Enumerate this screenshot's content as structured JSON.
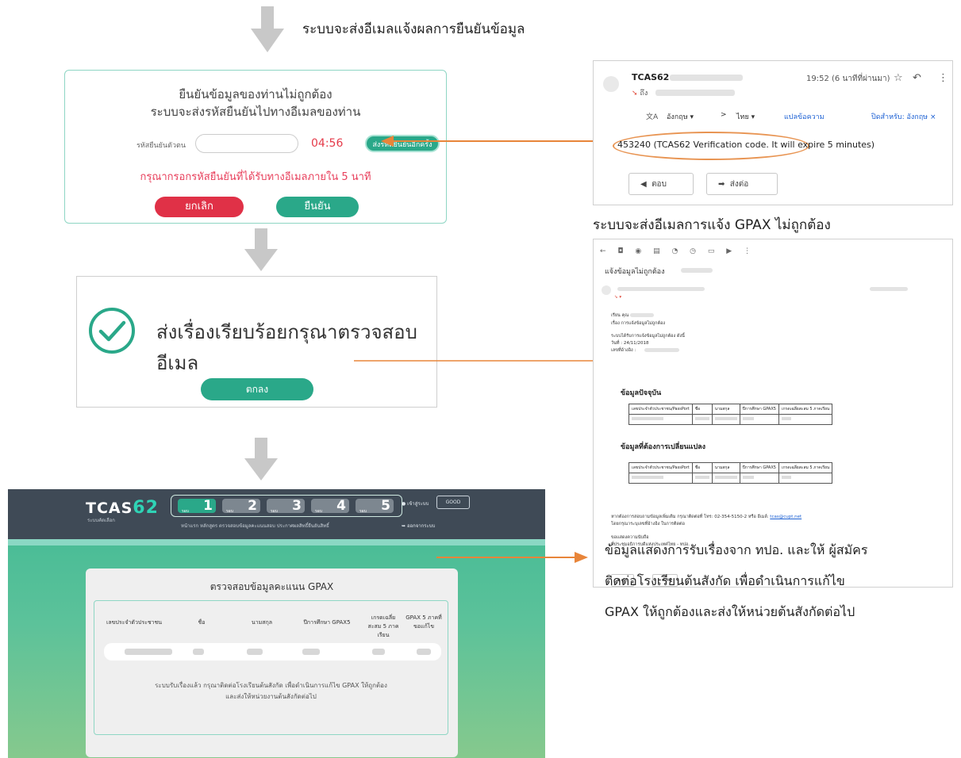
{
  "step_caption_top": "ระบบจะส่งอีเมลแจ้งผลการยืนยันข้อมูล",
  "caption_gpax_email": "ระบบจะส่งอีเมลการแจ้ง GPAX ไม่ถูกต้อง",
  "caption_bottom": [
    "ข้อมูลแสดงการรับเรื่องจาก ทปอ. และให้ ผู้สมัคร",
    "ติดต่อโรงเรียนต้นสังกัด เพื่อดำเนินการแก้ไข",
    "GPAX ให้ถูกต้องและส่งให้หน่วยต้นสังกัดต่อไป"
  ],
  "verify_panel": {
    "title_line1": "ยืนยันข้อมูลของท่านไม่ถูกต้อง",
    "title_line2": "ระบบจะส่งรหัสยืนยันไปทางอีเมลของท่าน",
    "code_label": "รหัสยืนยันตัวตน",
    "timer": "04:56",
    "resend_label": "ส่งรหัสยืนยันอีกครั้ง",
    "warning": "กรุณากรอกรหัสยืนยันที่ได้รับทางอีเมลภายใน 5 นาที",
    "cancel_label": "ยกเลิก",
    "confirm_label": "ยืนยัน"
  },
  "success_panel": {
    "message": "ส่งเรื่องเรียบร้อยกรุณาตรวจสอบอีเมล",
    "ok_label": "ตกลง"
  },
  "site": {
    "logo_text": "TCAS",
    "logo_number": "62",
    "logo_sub": "ระบบคัดเลือก",
    "rounds": [
      {
        "label": "รอบ",
        "num": "1",
        "color": "#2aa889"
      },
      {
        "label": "รอบ",
        "num": "2",
        "color": "#7d8790"
      },
      {
        "label": "รอบ",
        "num": "3",
        "color": "#7d8790"
      },
      {
        "label": "รอบ",
        "num": "4",
        "color": "#7d8790"
      },
      {
        "label": "รอบ",
        "num": "5",
        "color": "#7d8790"
      }
    ],
    "nav_links": "หน้าแรก   หลักสูตร   ตรวจสอบข้อมูลคะแนนสอบ   ประกาศผลสิทธิ์ยืนยันสิทธิ์",
    "login_label": "เข้าสู่ระบบ",
    "login_box": "GOOD",
    "logout_label": "ออกจากระบบ",
    "card_title": "ตรวจสอบข้อมูลคะแนน GPAX",
    "table_headers": [
      "เลขประจำตัวประชาชน",
      "ชื่อ",
      "นามสกุล",
      "ปีการศึกษา GPAX5",
      "เกรดเฉลี่ยสะสม 5 ภาคเรียน",
      "GPAX 5 ภาคที่ขอแก้ไข"
    ],
    "note_line1": "ระบบรับเรื่องแล้ว กรุณาติดต่อโรงเรียนต้นสังกัด เพื่อดำเนินการแก้ไข GPAX ให้ถูกต้อง",
    "note_line2": "และส่งให้หน่วยงานต้นสังกัดต่อไป"
  },
  "email1": {
    "sender": "TCAS62",
    "time": "19:52 (6 นาทีที่ผ่านมา)",
    "to": "ถึง",
    "translate_from": "อังกฤษ ▾",
    "translate_arrow": ">",
    "translate_to": "ไทย ▾",
    "translate_link": "แปลข้อความ",
    "translate_off": "ปิดสำหรับ: อังกฤษ ×",
    "code_text": "453240 (TCAS62 Verification code. It will expire 5 minutes)",
    "reply_label": "ตอบ",
    "forward_label": "ส่งต่อ"
  },
  "email2": {
    "subject": "แจ้งข้อมูลไม่ถูกต้อง",
    "lines": [
      "เรียน คุณ",
      "เรื่อง การแจ้งข้อมูลไม่ถูกต้อง",
      "ระบบได้รับการแจ้งข้อมูลไม่ถูกต้อง ดังนี้",
      "วันที่ : 24/11/2018",
      "เลขที่อ้างอิง :"
    ],
    "section1": "ข้อมูลปัจจุบัน",
    "section2": "ข้อมูลที่ต้องการเปลี่ยนแปลง",
    "table_headers": [
      "เลขประจำตัวประชาชน/PassPort",
      "ชื่อ",
      "นามสกุล",
      "ปีการศึกษา GPAX5",
      "เกรดเฉลี่ยสะสม 5 ภาคเรียน"
    ],
    "contact_line1": "หากต้องการสอบถามข้อมูลเพิ่มเติม กรุณาติดต่อที่ โทร: 02-354-5150-2 หรือ อีเมล์: ",
    "contact_email": "tcas@cupt.net",
    "contact_line2": "โดยกรุณาระบุเลขที่อ้างอิง ในการติดต่อ",
    "sign1": "ขอแสดงความนับถือ",
    "sign2": "ที่ประชุมอธิการบดีแห่งประเทศไทย - ทปอ.",
    "reply_label": "ตอบ",
    "forward_label": "ส่งต่อ"
  }
}
